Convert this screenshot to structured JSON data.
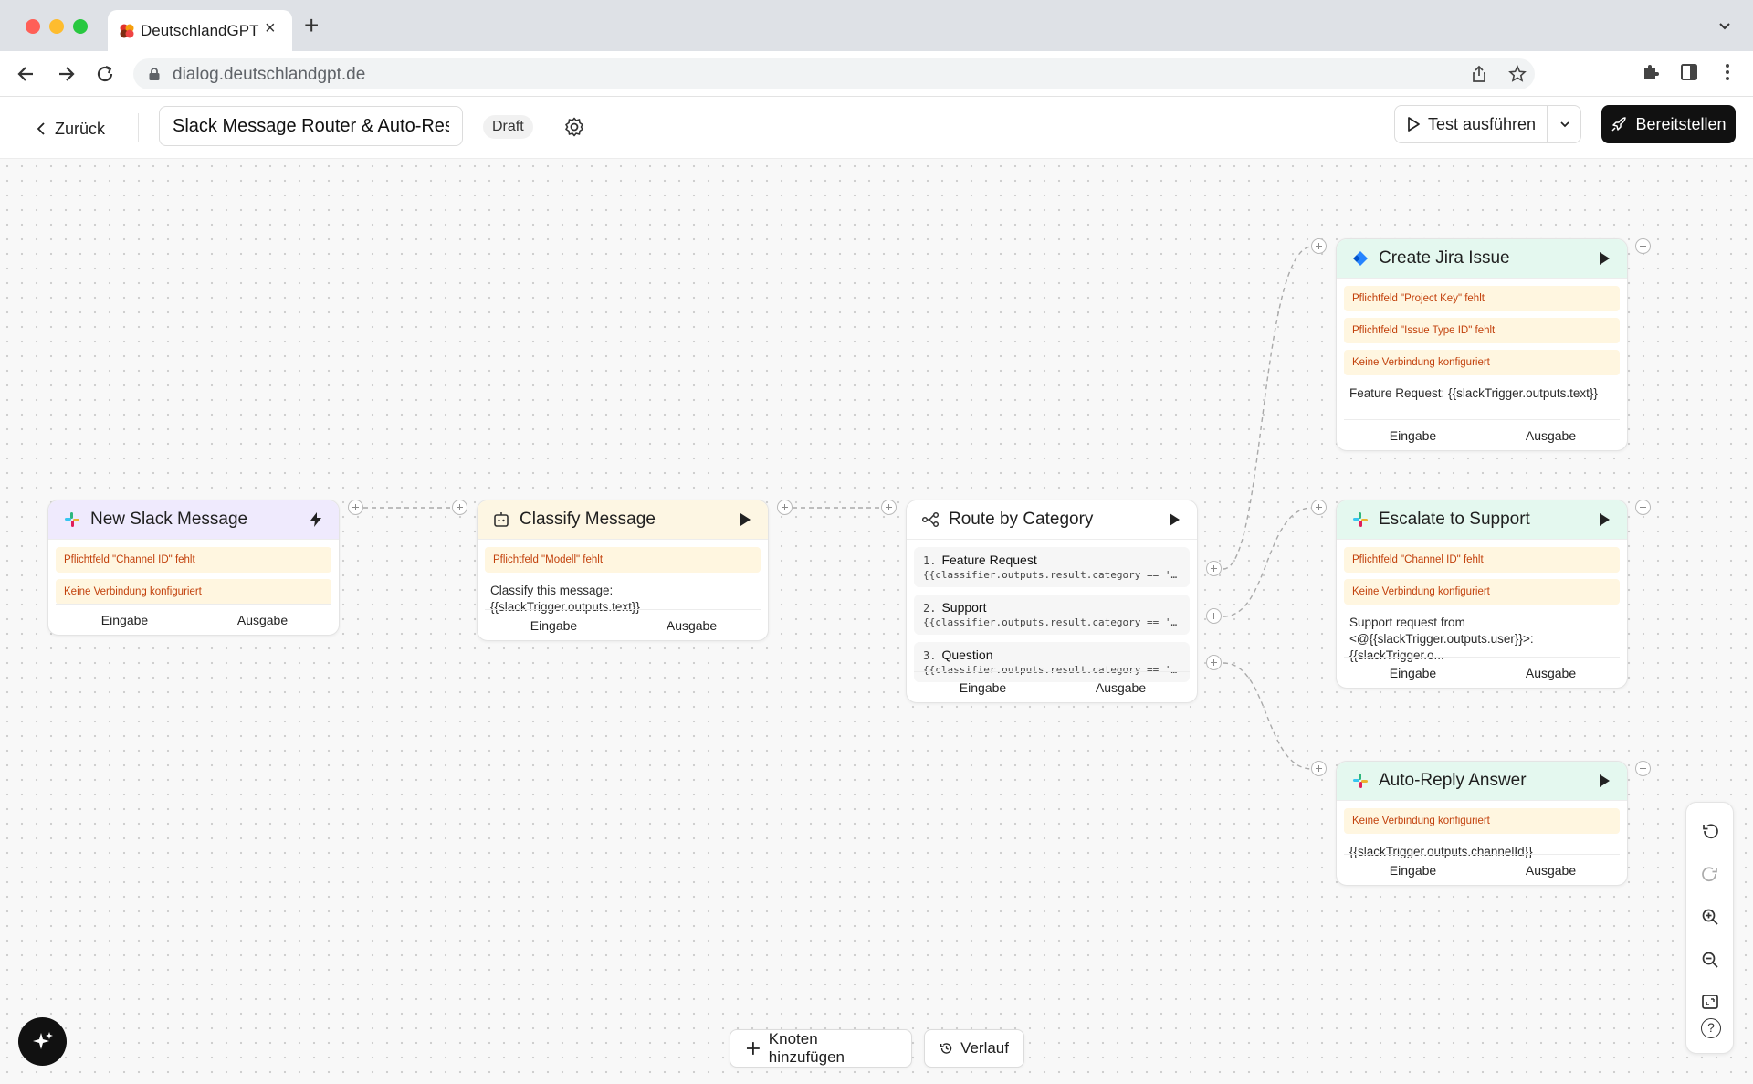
{
  "browser": {
    "tab_title": "DeutschlandGPT",
    "url": "dialog.deutschlandgpt.de"
  },
  "header": {
    "back_label": "Zurück",
    "workflow_title": "Slack Message Router & Auto-Respond",
    "status": "Draft",
    "test_label": "Test ausführen",
    "deploy_label": "Bereitstellen"
  },
  "ports": {
    "input": "Eingabe",
    "output": "Ausgabe"
  },
  "nodes": {
    "slack_trigger": {
      "title": "New Slack Message",
      "warnings": [
        "Pflichtfeld \"Channel ID\" fehlt",
        "Keine Verbindung konfiguriert"
      ]
    },
    "classifier": {
      "title": "Classify Message",
      "warnings": [
        "Pflichtfeld \"Modell\" fehlt"
      ],
      "text": "Classify this message: {{slackTrigger.outputs.text}}"
    },
    "router": {
      "title": "Route by Category",
      "routes": [
        {
          "num": "1.",
          "label": "Feature Request",
          "condition": "{{classifier.outputs.result.category == 'feature_request'}}"
        },
        {
          "num": "2.",
          "label": "Support",
          "condition": "{{classifier.outputs.result.category == 'support'}}"
        },
        {
          "num": "3.",
          "label": "Question",
          "condition": "{{classifier.outputs.result.category == 'question'}}"
        }
      ]
    },
    "jira": {
      "title": "Create Jira Issue",
      "warnings": [
        "Pflichtfeld \"Project Key\" fehlt",
        "Pflichtfeld \"Issue Type ID\" fehlt",
        "Keine Verbindung konfiguriert"
      ],
      "text": "Feature Request: {{slackTrigger.outputs.text}}"
    },
    "escalate": {
      "title": "Escalate to Support",
      "warnings": [
        "Pflichtfeld \"Channel ID\" fehlt",
        "Keine Verbindung konfiguriert"
      ],
      "text": "Support request from <@{{slackTrigger.outputs.user}}>: {{slackTrigger.o..."
    },
    "autoreply": {
      "title": "Auto-Reply Answer",
      "warnings": [
        "Keine Verbindung konfiguriert"
      ],
      "text": "{{slackTrigger.outputs.channelId}}"
    }
  },
  "toolbar": {
    "add_node_label": "Knoten hinzufügen",
    "history_label": "Verlauf",
    "help_label": "?"
  },
  "colors": {
    "trigger_header": "#efeafd",
    "classifier_header": "#fdf6e3",
    "action_header": "#e4f8ef",
    "warning_bg": "#fff6e0",
    "warning_text": "#c2410c",
    "deploy_bg": "#111111"
  }
}
